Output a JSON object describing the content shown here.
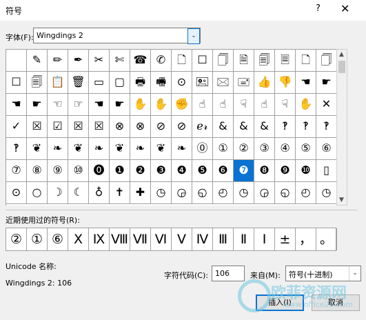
{
  "window": {
    "title": "符号",
    "help_icon": "?",
    "close_icon": "✕"
  },
  "font": {
    "label": "字体(F):",
    "value": "Wingdings 2",
    "arrow_icon": "⌄"
  },
  "grid": {
    "columns": 16,
    "selected_index": 91,
    "rows": [
      [
        "",
        "✎",
        "✏",
        "✒",
        "✂",
        "✄",
        "☎",
        "✆",
        "🗋",
        "☐",
        "🗍",
        "🗎",
        "🗐",
        "🗏",
        "🗋",
        "🗍"
      ],
      [
        "☐",
        "🗐",
        "📋",
        "🗑",
        "▭",
        "▢",
        "🖶",
        "🖷",
        "⊙",
        "🖭",
        "🖂",
        "🖃",
        "👍",
        "👎",
        "☚",
        "☛"
      ],
      [
        "☚",
        "☛",
        "☜",
        "☞",
        "☚",
        "☛",
        "✋",
        "✋",
        "✊",
        "☝",
        "☝",
        "☟",
        "☝",
        "☟",
        "✋",
        "✕"
      ],
      [
        "✓",
        "☒",
        "☑",
        "☒",
        "☒",
        "⊗",
        "⊗",
        "⊘",
        "⊘",
        "ℯ𝓇",
        "&",
        "&",
        "&",
        "‽",
        "‽",
        "‽"
      ],
      [
        "‽",
        "❦",
        "❧",
        "❦",
        "❧",
        "❦",
        "❧",
        "❦",
        "❧",
        "⓪",
        "①",
        "②",
        "③",
        "④",
        "⑤",
        "⑥"
      ],
      [
        "⑦",
        "⑧",
        "⑨",
        "⑩",
        "⓿",
        "❶",
        "❷",
        "❸",
        "❹",
        "❺",
        "❻",
        "❼",
        "❽",
        "❾",
        "❿",
        "▯"
      ],
      [
        "⊙",
        "○",
        "☽",
        "☾",
        "♁",
        "✝",
        "✚",
        "◷",
        "◶",
        "◵",
        "◴",
        "◷",
        "◶",
        "◵",
        "◴",
        "◷"
      ]
    ]
  },
  "recent": {
    "label": "近期使用过的符号(R):",
    "symbols": [
      "②",
      "①",
      "⑥",
      "Ⅹ",
      "Ⅸ",
      "Ⅷ",
      "Ⅶ",
      "Ⅵ",
      "Ⅴ",
      "Ⅳ",
      "Ⅲ",
      "Ⅱ",
      "Ⅰ",
      "±",
      "，",
      "。"
    ]
  },
  "info": {
    "unicode_name_label": "Unicode 名称:",
    "name_value": "Wingdings 2: 106",
    "char_code_label": "字符代码(C):",
    "char_code_value": "106",
    "from_label": "来自(M):",
    "from_value": "符号(十进制)"
  },
  "buttons": {
    "insert": "插入(I)",
    "cancel": "取消"
  },
  "watermark": {
    "text": "欧菲资源网",
    "url": "www.office26.com"
  },
  "colors": {
    "selection": "#0a73d1"
  }
}
